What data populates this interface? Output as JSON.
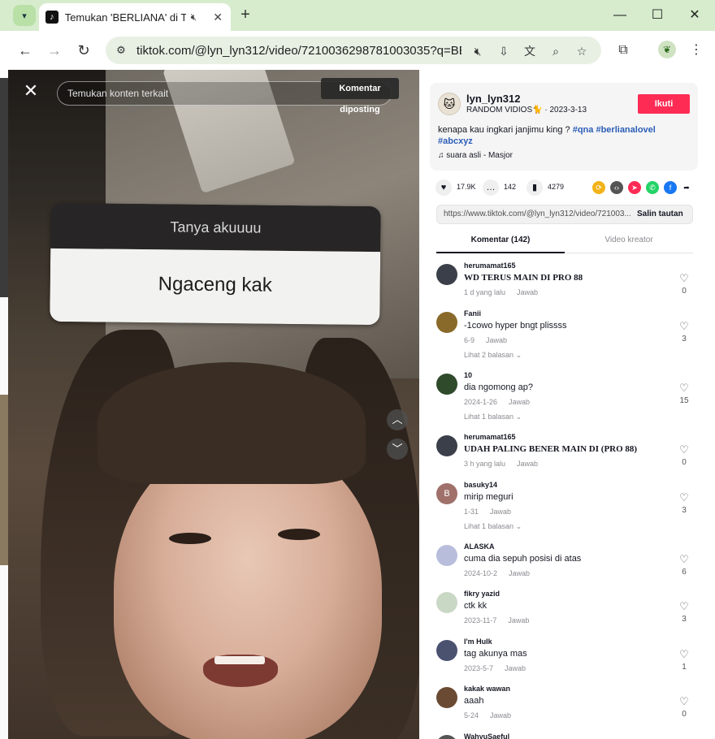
{
  "browser": {
    "tab_title": "Temukan 'BERLIANA' di TikT",
    "url": "tiktok.com/@lyn_lyn312/video/7210036298781003035?q=BER...",
    "new_tab": "+",
    "tab_close": "✕"
  },
  "video": {
    "search_placeholder": "Temukan konten terkait",
    "tooltip": "Komentar diposting",
    "qna_header": "Tanya akuuuu",
    "qna_answer": "Ngaceng kak"
  },
  "panel": {
    "author": {
      "username": "lyn_lyn312",
      "subtitle": "RANDOM VIDIOS🐈 · 2023-3-13",
      "follow_label": "Ikuti"
    },
    "caption_text": "kenapa kau ingkari janjimu king ? ",
    "tags": [
      "#qna",
      "#berlianalovel",
      "#abcxyz"
    ],
    "music": "suara asli - Masjor",
    "stats": {
      "likes": "17.9K",
      "comments": "142",
      "saves": "4279"
    },
    "link": {
      "url": "https://www.tiktok.com/@lyn_lyn312/video/721003...",
      "copy_label": "Salin tautan"
    },
    "tabs": {
      "comments": "Komentar (142)",
      "creator_videos": "Video kreator"
    },
    "reply_label": "Jawab",
    "comments": [
      {
        "user": "herumamat165",
        "text": "WD TERUS MAIN DI PRO 88",
        "date": "1 d yang lalu",
        "likes": "0",
        "more": "",
        "avatar_color": "#3a3f4a"
      },
      {
        "user": "Fanii",
        "text": "-1cowo hyper bngt plissss",
        "date": "6-9",
        "likes": "3",
        "more": "Lihat 2 balasan",
        "avatar_color": "#8a6a2a"
      },
      {
        "user": "10",
        "text": "dia ngomong ap?",
        "date": "2024-1-26",
        "likes": "15",
        "more": "Lihat 1 balasan",
        "avatar_color": "#2e4a2a"
      },
      {
        "user": "herumamat165",
        "text": "UDAH PALING BENER MAIN DI (PRO 88)",
        "date": "3 h yang lalu",
        "likes": "0",
        "more": "",
        "avatar_color": "#3a3f4a"
      },
      {
        "user": "basuky14",
        "text": "mirip meguri",
        "date": "1-31",
        "likes": "3",
        "more": "Lihat 1 balasan",
        "avatar_color": "#a0706a",
        "avatar_letter": "B"
      },
      {
        "user": "ALASKA",
        "text": "cuma dia sepuh posisi di atas",
        "date": "2024-10-2",
        "likes": "6",
        "more": "",
        "avatar_color": "#b8bddc"
      },
      {
        "user": "fikry yazid",
        "text": "ctk kk",
        "date": "2023-11-7",
        "likes": "3",
        "more": "",
        "avatar_color": "#c9d8c4"
      },
      {
        "user": "I'm Hulk",
        "text": "tag akunya mas",
        "date": "2023-5-7",
        "likes": "1",
        "more": "",
        "avatar_color": "#4a5270"
      },
      {
        "user": "kakak wawan",
        "text": "aaah",
        "date": "5-24",
        "likes": "0",
        "more": "",
        "avatar_color": "#6a4a32"
      },
      {
        "user": "WahyuSaeful",
        "text": "",
        "date": "",
        "likes": "",
        "more": "",
        "avatar_color": "#555"
      }
    ]
  },
  "colors": {
    "follow": "#fe2c55",
    "tag": "#2b5db8",
    "chrome_bg": "#d6eccd"
  }
}
